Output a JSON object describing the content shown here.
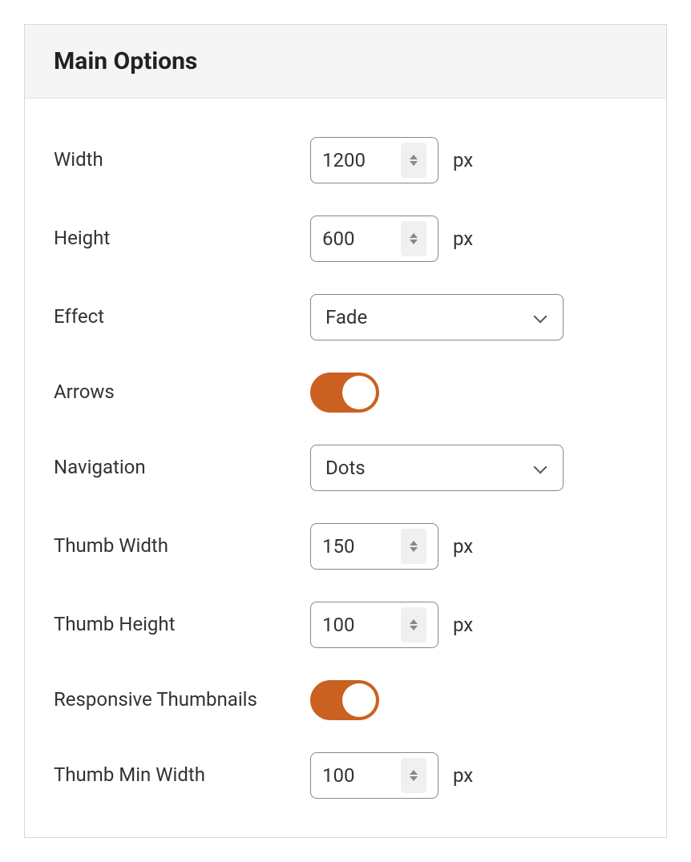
{
  "panel": {
    "title": "Main Options"
  },
  "fields": {
    "width": {
      "label": "Width",
      "value": "1200",
      "unit": "px"
    },
    "height": {
      "label": "Height",
      "value": "600",
      "unit": "px"
    },
    "effect": {
      "label": "Effect",
      "value": "Fade"
    },
    "arrows": {
      "label": "Arrows",
      "on": true
    },
    "navigation": {
      "label": "Navigation",
      "value": "Dots"
    },
    "thumbWidth": {
      "label": "Thumb Width",
      "value": "150",
      "unit": "px"
    },
    "thumbHeight": {
      "label": "Thumb Height",
      "value": "100",
      "unit": "px"
    },
    "responsiveThumbs": {
      "label": "Responsive Thumbnails",
      "on": true
    },
    "thumbMinWidth": {
      "label": "Thumb Min Width",
      "value": "100",
      "unit": "px"
    }
  }
}
